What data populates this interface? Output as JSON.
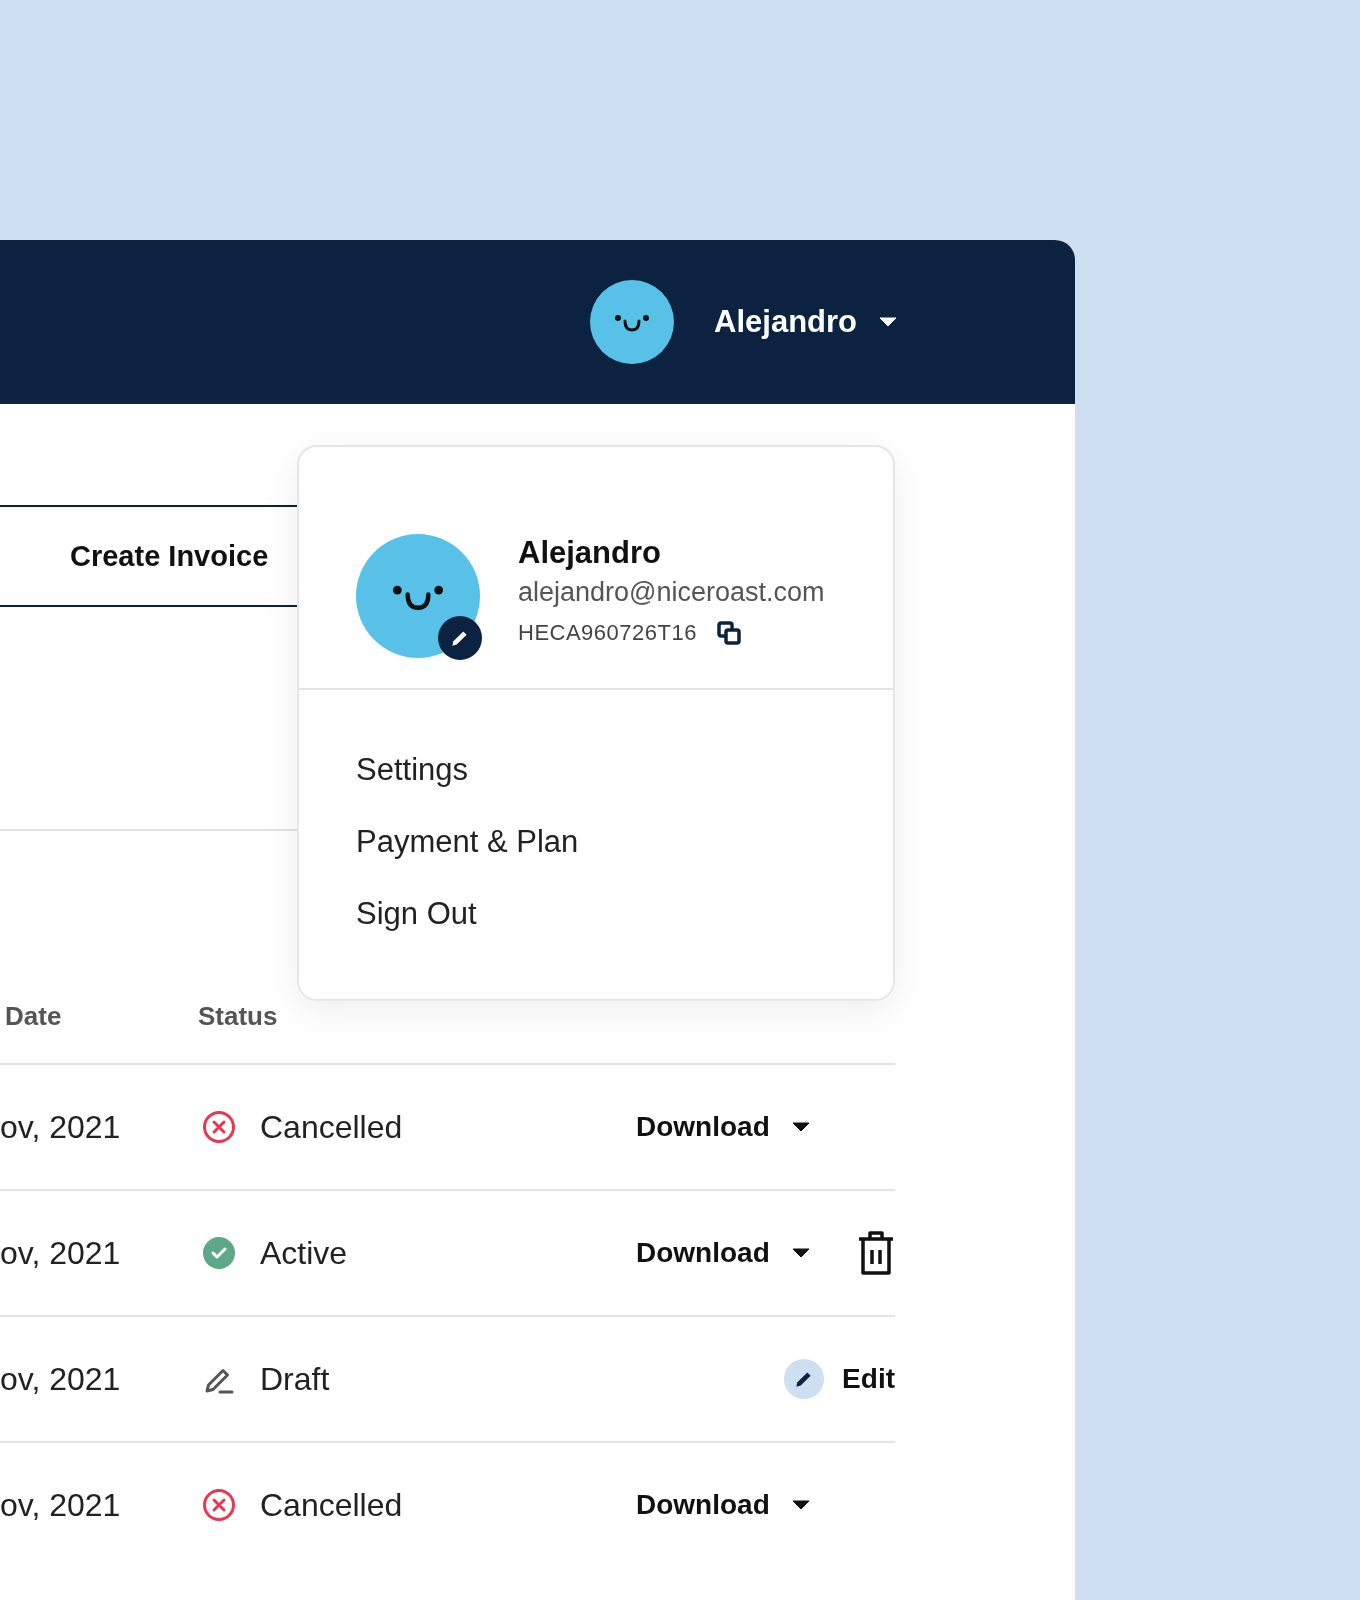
{
  "header": {
    "user_name": "Alejandro"
  },
  "create_invoice": {
    "label": "Create Invoice"
  },
  "profile_menu": {
    "expanded": true,
    "name": "Alejandro",
    "email": "alejandro@niceroast.com",
    "account_id": "HECA960726T16",
    "items": [
      "Settings",
      "Payment & Plan",
      "Sign Out"
    ]
  },
  "table": {
    "columns": [
      "Date",
      "Status"
    ],
    "rows": [
      {
        "date": "ov, 2021",
        "status": {
          "label": "Cancelled",
          "kind": "cancelled"
        },
        "actions": [
          {
            "kind": "download",
            "label": "Download"
          }
        ]
      },
      {
        "date": "ov, 2021",
        "status": {
          "label": "Active",
          "kind": "active"
        },
        "actions": [
          {
            "kind": "download",
            "label": "Download"
          },
          {
            "kind": "delete"
          }
        ]
      },
      {
        "date": "ov, 2021",
        "status": {
          "label": "Draft",
          "kind": "draft"
        },
        "actions": [
          {
            "kind": "edit",
            "label": "Edit"
          }
        ]
      },
      {
        "date": "ov, 2021",
        "status": {
          "label": "Cancelled",
          "kind": "cancelled"
        },
        "actions": [
          {
            "kind": "download",
            "label": "Download"
          }
        ]
      }
    ]
  }
}
